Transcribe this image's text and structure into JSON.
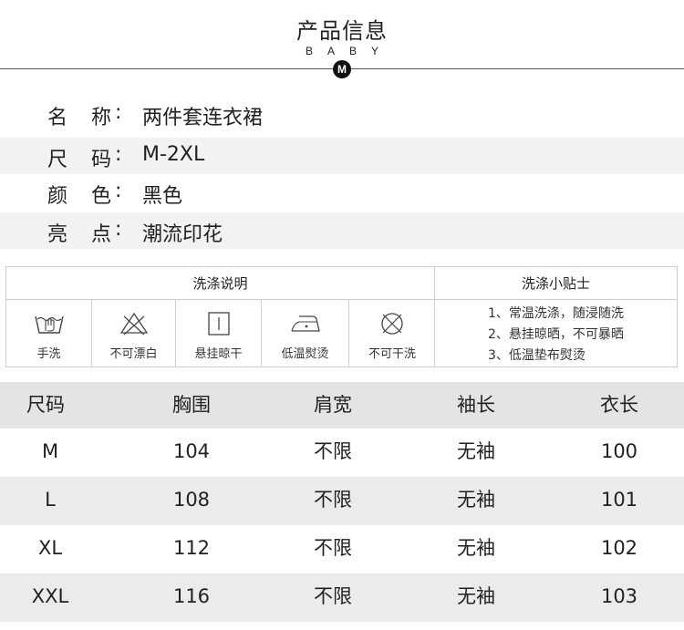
{
  "header": {
    "title": "产品信息",
    "subtitle": "BABY",
    "badge": "M"
  },
  "info": [
    {
      "k1": "名",
      "k2": "称",
      "colon": ":",
      "value": "两件套连衣裙"
    },
    {
      "k1": "尺",
      "k2": "码",
      "colon": ":",
      "value": "M-2XL"
    },
    {
      "k1": "颜",
      "k2": "色",
      "colon": ":",
      "value": "黑色"
    },
    {
      "k1": "亮",
      "k2": "点",
      "colon": ":",
      "value": "潮流印花"
    }
  ],
  "washing": {
    "heading": "洗涤说明",
    "tips_heading": "洗涤小贴士",
    "items": [
      {
        "label": "手洗",
        "icon": "hand-wash-icon"
      },
      {
        "label": "不可漂白",
        "icon": "no-bleach-icon"
      },
      {
        "label": "悬挂晾干",
        "icon": "hang-dry-icon"
      },
      {
        "label": "低温熨烫",
        "icon": "low-iron-icon"
      },
      {
        "label": "不可干洗",
        "icon": "no-dry-clean-icon"
      }
    ],
    "tips": [
      "1、常温洗涤，随浸随洗",
      "2、悬挂晾晒，不可暴晒",
      "3、低温垫布熨烫"
    ]
  },
  "size_table": {
    "headers": [
      "尺码",
      "胸围",
      "肩宽",
      "袖长",
      "衣长"
    ],
    "rows": [
      [
        "M",
        "104",
        "不限",
        "无袖",
        "100"
      ],
      [
        "L",
        "108",
        "不限",
        "无袖",
        "101"
      ],
      [
        "XL",
        "112",
        "不限",
        "无袖",
        "102"
      ],
      [
        "XXL",
        "116",
        "不限",
        "无袖",
        "103"
      ]
    ]
  }
}
